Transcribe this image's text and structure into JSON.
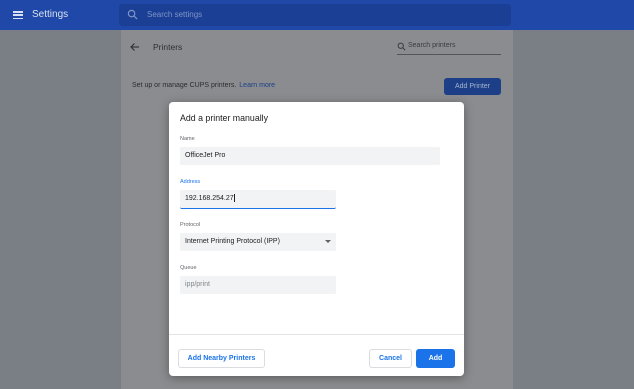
{
  "topbar": {
    "title": "Settings",
    "search_placeholder": "Search settings"
  },
  "printers_page": {
    "title": "Printers",
    "search_placeholder": "Search printers",
    "description": "Set up or manage CUPS printers.",
    "learn_more": "Learn more",
    "add_printer_label": "Add Printer"
  },
  "dialog": {
    "title": "Add a printer manually",
    "name": {
      "label": "Name",
      "value": "OfficeJet Pro"
    },
    "address": {
      "label": "Address",
      "value": "192.168.254.27"
    },
    "protocol": {
      "label": "Protocol",
      "value": "Internet Printing Protocol (IPP)"
    },
    "queue": {
      "label": "Queue",
      "placeholder": "ipp/print"
    },
    "add_nearby_label": "Add Nearby Printers",
    "cancel_label": "Cancel",
    "add_label": "Add"
  },
  "colors": {
    "accent": "#1a73e8",
    "topbar": "#1f48a8"
  }
}
